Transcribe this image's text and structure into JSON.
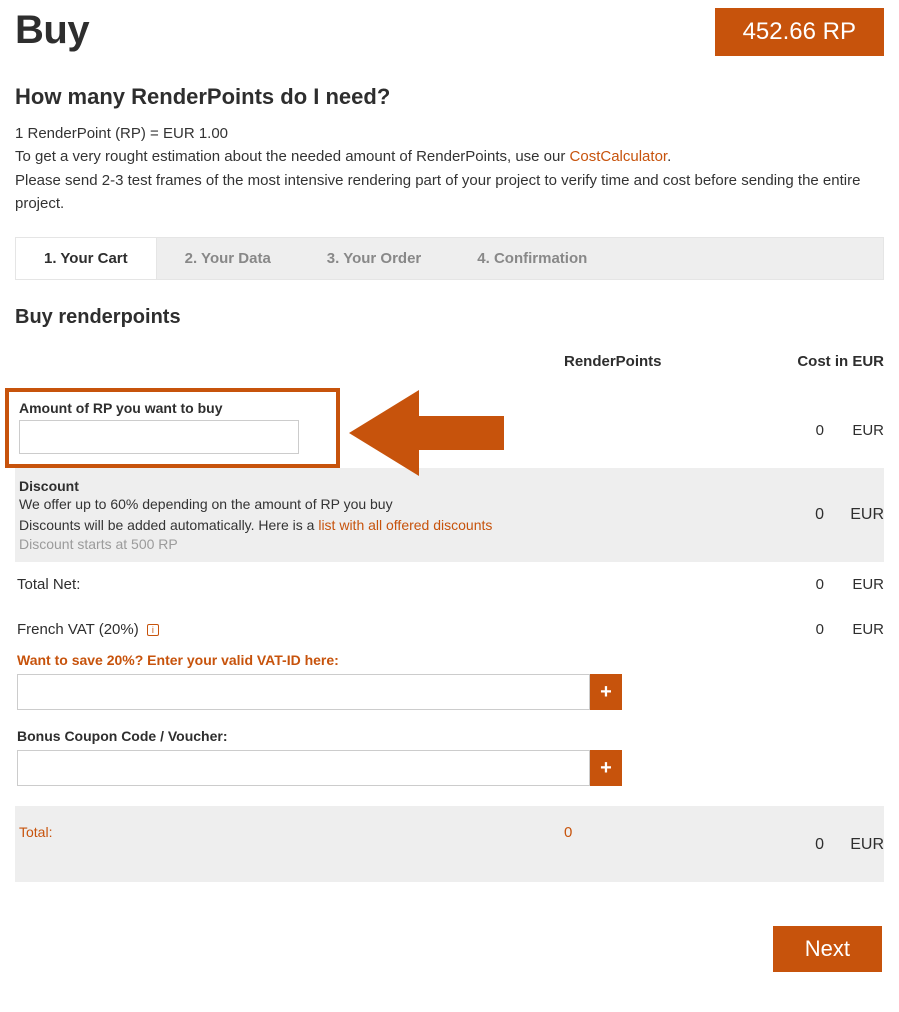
{
  "header": {
    "title": "Buy",
    "balance": "452.66 RP"
  },
  "intro": {
    "question": "How many RenderPoints do I need?",
    "line1": "1 RenderPoint (RP) = EUR 1.00",
    "line2a": "To get a very rought estimation about the needed amount of RenderPoints, use our ",
    "line2link": "CostCalculator",
    "line2b": ".",
    "line3": "Please send 2-3 test frames of the most intensive rendering part of your project to verify time and cost before sending the entire project."
  },
  "tabs": [
    {
      "label": "1. Your Cart",
      "active": true
    },
    {
      "label": "2. Your Data",
      "active": false
    },
    {
      "label": "3. Your Order",
      "active": false
    },
    {
      "label": "4. Confirmation",
      "active": false
    }
  ],
  "section": {
    "title": "Buy renderpoints"
  },
  "table": {
    "head_rp": "RenderPoints",
    "head_cost": "Cost in EUR",
    "amount_label": "Amount of RP you want to buy",
    "amount_value": "",
    "amount_cost": "0",
    "currency": "EUR",
    "discount": {
      "title": "Discount",
      "line1": "We offer up to 60% depending on the amount of RP you buy",
      "line2a": "Discounts will be added automatically. Here is a ",
      "line2link": "list with all offered discounts",
      "line3": "Discount starts at 500 RP",
      "value": "0"
    },
    "totalnet": {
      "label": "Total Net:",
      "value": "0"
    },
    "vat": {
      "label": "French VAT (20%)",
      "value": "0"
    },
    "vat_save_label": "Want to save 20%? Enter your valid VAT-ID here:",
    "coupon_label": "Bonus Coupon Code / Voucher:",
    "total": {
      "label": "Total:",
      "rp": "0",
      "value": "0"
    }
  },
  "actions": {
    "next": "Next"
  }
}
